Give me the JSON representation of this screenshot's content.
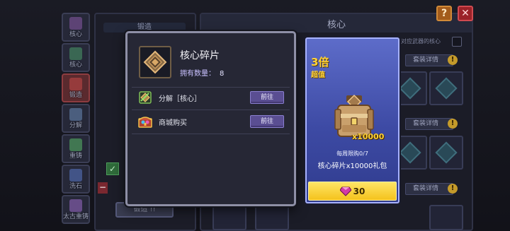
{
  "background": {
    "side_nav": [
      {
        "label": "核心",
        "color": "#8a5aa8"
      },
      {
        "label": "核心",
        "color": "#4a9a6a"
      },
      {
        "label": "锻造",
        "color": "#c84848",
        "active": true
      },
      {
        "label": "分解",
        "color": "#6a8ab8"
      },
      {
        "label": "重铸",
        "color": "#58b868"
      },
      {
        "label": "洗石",
        "color": "#5a78c8"
      },
      {
        "label": "太古重铸",
        "color": "#9a6ac8"
      }
    ],
    "forge_title": "锻造",
    "forge_button": "锻造 !!",
    "core_title": "核心",
    "help": "?",
    "close": "✕",
    "sync_label": "对应武器的核心",
    "set_detail_label": "套装详情",
    "warn": "!",
    "minus": "−",
    "check": "✓"
  },
  "modal": {
    "item_name": "核心碎片",
    "owned_label": "拥有数量：",
    "owned_count": "8",
    "rows": [
      {
        "label": "分解［核心］",
        "button": "前往",
        "icon": "decompose-icon"
      },
      {
        "label": "商城购买",
        "button": "前往",
        "icon": "shop-chest-icon"
      }
    ]
  },
  "offer": {
    "multiplier": "3倍",
    "value_tag": "超值",
    "quantity": "x10000",
    "weekly_limit": "每周限购0/7",
    "pack_name": "核心碎片x10000礼包",
    "price": "30",
    "accent": "#ffd23a"
  }
}
